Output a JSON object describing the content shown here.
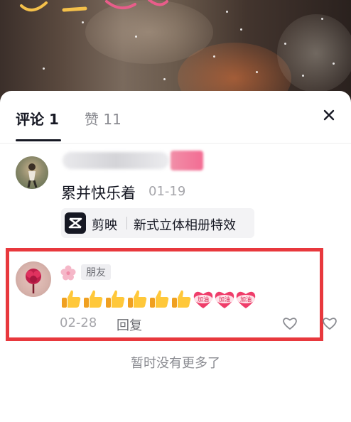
{
  "tabs": {
    "comments_label": "评论 1",
    "likes_label": "赞 11"
  },
  "comments": [
    {
      "text": "累并快乐着",
      "date": "01-19",
      "app_chip": {
        "name": "剪映",
        "description": "新式立体相册特效"
      }
    },
    {
      "badge": "朋友",
      "emoji_sequence": [
        "thumbs-up",
        "thumbs-up",
        "thumbs-up",
        "thumbs-up",
        "thumbs-up",
        "thumbs-up",
        "cheer-heart",
        "cheer-heart",
        "cheer-heart"
      ],
      "cheer_text": "加油",
      "date": "02-28",
      "reply_label": "回复"
    }
  ],
  "footer": {
    "end_text": "暂时没有更多了"
  },
  "colors": {
    "highlight_border": "#e8383d",
    "text_primary": "#161823",
    "text_secondary": "#a6a6ab"
  }
}
